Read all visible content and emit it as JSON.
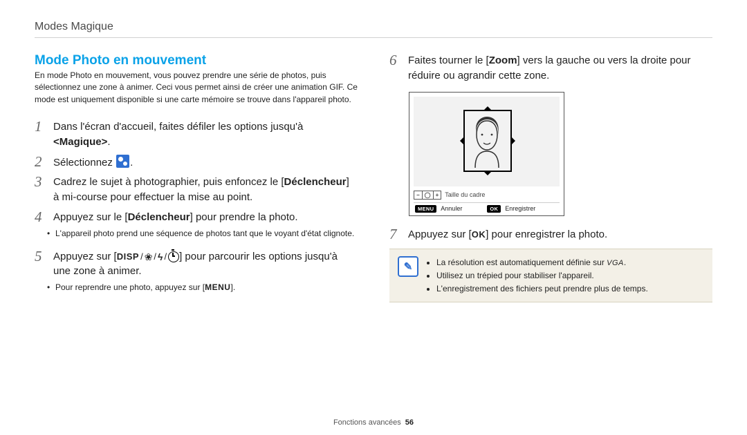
{
  "breadcrumb": "Modes Magique",
  "section_title": "Mode Photo en mouvement",
  "intro": "En mode Photo en mouvement, vous pouvez prendre une série de photos, puis sélectionnez une zone à animer. Ceci vous permet ainsi de créer une animation GIF. Ce mode est uniquement disponible si une carte mémoire se trouve dans l'appareil photo.",
  "left_steps": {
    "s1_a": "Dans l'écran d'accueil, faites défiler les options jusqu'à ",
    "s1_b": "<Magique>",
    "s1_c": ".",
    "s2": "Sélectionnez ",
    "s2_end": ".",
    "s3_a": "Cadrez le sujet à photographier, puis enfoncez le [",
    "s3_b": "Déclencheur",
    "s3_c": "] à mi-course pour effectuer la mise au point.",
    "s4_a": "Appuyez sur le [",
    "s4_b": "Déclencheur",
    "s4_c": "] pour prendre la photo.",
    "s4_sub": "L'appareil photo prend une séquence de photos tant que le voyant d'état clignote.",
    "s5_a": "Appuyez sur [",
    "s5_disp": "DISP",
    "s5_b": "] pour parcourir les options jusqu'à une zone à animer.",
    "s5_sub_a": "Pour reprendre une photo, appuyez sur [",
    "s5_sub_menu": "MENU",
    "s5_sub_b": "]."
  },
  "right_steps": {
    "s6_a": "Faites tourner le [",
    "s6_b": "Zoom",
    "s6_c": "] vers la gauche ou vers la droite pour réduire ou agrandir cette zone.",
    "s7_a": "Appuyez sur [",
    "s7_ok": "OK",
    "s7_b": "] pour enregistrer la photo."
  },
  "lcd": {
    "frame_caption": "Taille du cadre",
    "menu_label": "MENU",
    "cancel": "Annuler",
    "ok_label": "OK",
    "save": "Enregistrer",
    "zoom_minus": "−",
    "zoom_mid": "◯",
    "zoom_plus": "+"
  },
  "notes": {
    "n1_a": "La résolution est automatiquement définie sur ",
    "n1_vga": "VGA",
    "n1_b": ".",
    "n2": "Utilisez un trépied pour stabiliser l'appareil.",
    "n3": "L'enregistrement des fichiers peut prendre plus de temps."
  },
  "footer": {
    "label": "Fonctions avancées",
    "page": "56"
  }
}
